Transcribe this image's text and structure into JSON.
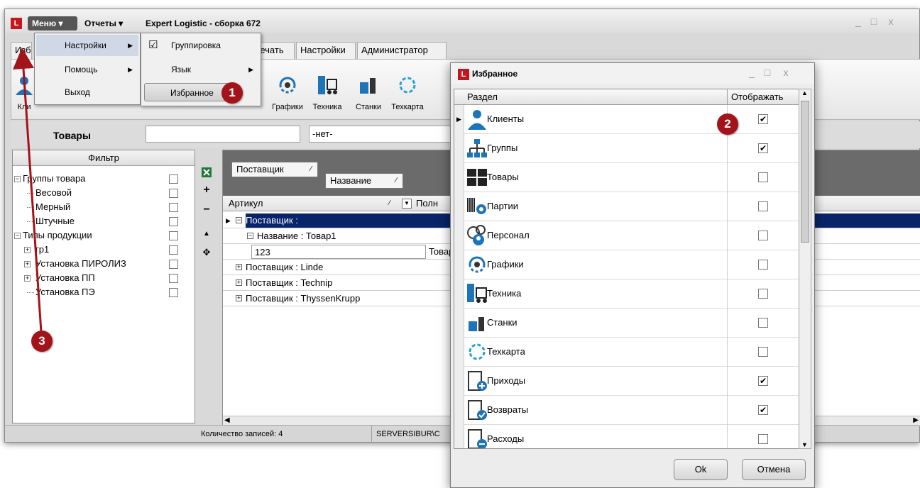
{
  "app": {
    "logo": "L",
    "menu_label": "Меню ▾",
    "reports_label": "Отчеты ▾",
    "title": "Expert Logistic - сборка 672"
  },
  "tabs": [
    "Изб",
    "д",
    "Печать",
    "Настройки",
    "Администратор"
  ],
  "ribbon": [
    {
      "label": "Кли",
      "icon": "clients-icon"
    },
    {
      "label": "Графики",
      "icon": "schedules-icon"
    },
    {
      "label": "Техника",
      "icon": "equipment-icon"
    },
    {
      "label": "Станки",
      "icon": "machines-icon"
    },
    {
      "label": "Техкарта",
      "icon": "techcard-icon"
    }
  ],
  "main_menu": [
    {
      "label": "Настройки",
      "has_submenu": true
    },
    {
      "label": "Помощь",
      "has_submenu": true
    },
    {
      "label": "Выход",
      "has_submenu": false
    }
  ],
  "settings_submenu": [
    {
      "label": "Группировка",
      "checked": true
    },
    {
      "label": "Язык",
      "has_submenu": true
    },
    {
      "label": "Избранное",
      "highlighted": true
    }
  ],
  "goods_bar": {
    "label": "Товары",
    "search_value": "",
    "select_value": "-нет-"
  },
  "filter": {
    "header": "Фильтр",
    "items": [
      {
        "label": "Группы товара",
        "level": 0,
        "expander": "minus"
      },
      {
        "label": "Весовой",
        "level": 1
      },
      {
        "label": "Мерный",
        "level": 1
      },
      {
        "label": "Штучные",
        "level": 1
      },
      {
        "label": "Типы продукции",
        "level": 0,
        "expander": "minus"
      },
      {
        "label": "гр1",
        "level": 1,
        "expander": "plus"
      },
      {
        "label": "Установка ПИРОЛИЗ",
        "level": 1,
        "expander": "plus"
      },
      {
        "label": "Установка ПП",
        "level": 1,
        "expander": "plus"
      },
      {
        "label": "Установка ПЭ",
        "level": 1
      }
    ]
  },
  "grid": {
    "group_chips": [
      "Поставщик",
      "Название"
    ],
    "columns": [
      "Артикул",
      "Полн"
    ],
    "rows": [
      {
        "type": "group",
        "text": "Поставщик :",
        "expander": "minus",
        "selected": true
      },
      {
        "type": "subgroup",
        "text": "Название : Товар1",
        "expander": "minus"
      },
      {
        "type": "data",
        "article": "123",
        "full": "Товар"
      },
      {
        "type": "group",
        "text": "Поставщик : Linde",
        "expander": "plus"
      },
      {
        "type": "group",
        "text": "Поставщик : Technip",
        "expander": "plus"
      },
      {
        "type": "group",
        "text": "Поставщик : ThyssenKrupp",
        "expander": "plus"
      }
    ]
  },
  "status": {
    "records": "Количество записей: 4",
    "server": "SERVERSIBUR\\C"
  },
  "favorites": {
    "title": "Избранное",
    "col_section": "Раздел",
    "col_show": "Отображать",
    "items": [
      {
        "label": "Клиенты",
        "icon": "clients-icon",
        "checked": true
      },
      {
        "label": "Группы",
        "icon": "groups-icon",
        "checked": true
      },
      {
        "label": "Товары",
        "icon": "goods-icon",
        "checked": false
      },
      {
        "label": "Партии",
        "icon": "batches-icon",
        "checked": false
      },
      {
        "label": "Персонал",
        "icon": "personnel-icon",
        "checked": false
      },
      {
        "label": "Графики",
        "icon": "schedules-icon",
        "checked": false
      },
      {
        "label": "Техника",
        "icon": "equipment-icon",
        "checked": false
      },
      {
        "label": "Станки",
        "icon": "machines-icon",
        "checked": false
      },
      {
        "label": "Техкарта",
        "icon": "techcard-icon",
        "checked": false
      },
      {
        "label": "Приходы",
        "icon": "receipts-icon",
        "checked": true
      },
      {
        "label": "Возвраты",
        "icon": "returns-icon",
        "checked": true
      },
      {
        "label": "Расходы",
        "icon": "expenses-icon",
        "checked": false
      }
    ],
    "ok_label": "Ok",
    "cancel_label": "Отмена"
  },
  "badges": [
    "1",
    "2",
    "3"
  ],
  "colors": {
    "accent_red": "#a3141a",
    "selection_blue": "#0a246a",
    "icon_blue": "#1e74b8"
  }
}
